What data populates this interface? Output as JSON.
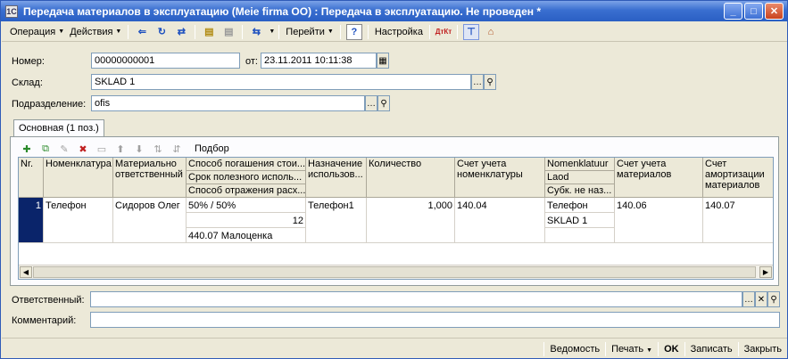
{
  "window": {
    "title": "Передача материалов в эксплуатацию (Meie firma OO) : Передача в эксплуатацию. Не проведен *",
    "app_icon": "1C",
    "minimize": "_",
    "maximize": "□",
    "close": "✕"
  },
  "toolbar": {
    "operation": "Операция",
    "actions": "Действия",
    "goto": "Перейти",
    "help": "?",
    "settings": "Настройка"
  },
  "form": {
    "number_label": "Номер:",
    "number_value": "00000000001",
    "date_label": "от:",
    "date_value": "23.11.2011 10:11:38",
    "warehouse_label": "Склад:",
    "warehouse_value": "SKLAD 1",
    "department_label": "Подразделение:",
    "department_value": "ofis",
    "responsible_label": "Ответственный:",
    "responsible_value": "",
    "comment_label": "Комментарий:",
    "comment_value": ""
  },
  "tab": {
    "label": "Основная (1 поз.)",
    "selection_label": "Подбор"
  },
  "table": {
    "headers": {
      "nr": "Nr.",
      "item": "Номенклатура",
      "mrp": "Материально ответственный",
      "method": "Способ погашения стои...",
      "useful_life": "Срок полезного исполь...",
      "reflect": "Способ отражения расх...",
      "purpose": "Назначение использов...",
      "qty": "Количество",
      "account_item": "Счет учета номенклатуры",
      "nomenclature": "Nomenklatuur",
      "warehouse": "Laod",
      "subconto": "Субк. не наз...",
      "account_mat": "Счет учета материалов",
      "account_amort": "Счет амортизации материалов"
    },
    "row": {
      "nr": "1",
      "item": "Телефон",
      "mrp": "Сидоров Олег",
      "method": "50% / 50%",
      "useful_life": "12",
      "reflect": "440.07 Малоценка",
      "purpose": "Телефон1",
      "qty": "1,000",
      "account_item": "140.04",
      "nomenclature": "Телефон",
      "warehouse": "SKLAD 1",
      "subconto": "",
      "account_mat": "140.06",
      "account_amort": "140.07"
    }
  },
  "bottom": {
    "statement": "Ведомость",
    "print": "Печать",
    "ok": "OK",
    "save": "Записать",
    "close": "Закрыть"
  }
}
